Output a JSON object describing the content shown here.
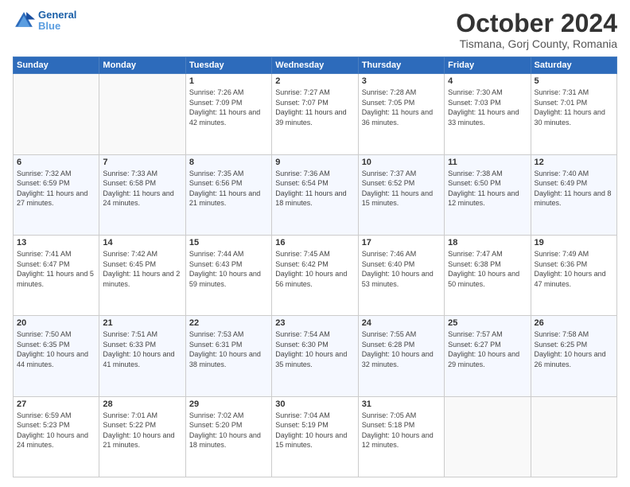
{
  "header": {
    "logo_line1": "General",
    "logo_line2": "Blue",
    "month": "October 2024",
    "location": "Tismana, Gorj County, Romania"
  },
  "weekdays": [
    "Sunday",
    "Monday",
    "Tuesday",
    "Wednesday",
    "Thursday",
    "Friday",
    "Saturday"
  ],
  "weeks": [
    [
      {
        "day": "",
        "sunrise": "",
        "sunset": "",
        "daylight": ""
      },
      {
        "day": "",
        "sunrise": "",
        "sunset": "",
        "daylight": ""
      },
      {
        "day": "1",
        "sunrise": "Sunrise: 7:26 AM",
        "sunset": "Sunset: 7:09 PM",
        "daylight": "Daylight: 11 hours and 42 minutes."
      },
      {
        "day": "2",
        "sunrise": "Sunrise: 7:27 AM",
        "sunset": "Sunset: 7:07 PM",
        "daylight": "Daylight: 11 hours and 39 minutes."
      },
      {
        "day": "3",
        "sunrise": "Sunrise: 7:28 AM",
        "sunset": "Sunset: 7:05 PM",
        "daylight": "Daylight: 11 hours and 36 minutes."
      },
      {
        "day": "4",
        "sunrise": "Sunrise: 7:30 AM",
        "sunset": "Sunset: 7:03 PM",
        "daylight": "Daylight: 11 hours and 33 minutes."
      },
      {
        "day": "5",
        "sunrise": "Sunrise: 7:31 AM",
        "sunset": "Sunset: 7:01 PM",
        "daylight": "Daylight: 11 hours and 30 minutes."
      }
    ],
    [
      {
        "day": "6",
        "sunrise": "Sunrise: 7:32 AM",
        "sunset": "Sunset: 6:59 PM",
        "daylight": "Daylight: 11 hours and 27 minutes."
      },
      {
        "day": "7",
        "sunrise": "Sunrise: 7:33 AM",
        "sunset": "Sunset: 6:58 PM",
        "daylight": "Daylight: 11 hours and 24 minutes."
      },
      {
        "day": "8",
        "sunrise": "Sunrise: 7:35 AM",
        "sunset": "Sunset: 6:56 PM",
        "daylight": "Daylight: 11 hours and 21 minutes."
      },
      {
        "day": "9",
        "sunrise": "Sunrise: 7:36 AM",
        "sunset": "Sunset: 6:54 PM",
        "daylight": "Daylight: 11 hours and 18 minutes."
      },
      {
        "day": "10",
        "sunrise": "Sunrise: 7:37 AM",
        "sunset": "Sunset: 6:52 PM",
        "daylight": "Daylight: 11 hours and 15 minutes."
      },
      {
        "day": "11",
        "sunrise": "Sunrise: 7:38 AM",
        "sunset": "Sunset: 6:50 PM",
        "daylight": "Daylight: 11 hours and 12 minutes."
      },
      {
        "day": "12",
        "sunrise": "Sunrise: 7:40 AM",
        "sunset": "Sunset: 6:49 PM",
        "daylight": "Daylight: 11 hours and 8 minutes."
      }
    ],
    [
      {
        "day": "13",
        "sunrise": "Sunrise: 7:41 AM",
        "sunset": "Sunset: 6:47 PM",
        "daylight": "Daylight: 11 hours and 5 minutes."
      },
      {
        "day": "14",
        "sunrise": "Sunrise: 7:42 AM",
        "sunset": "Sunset: 6:45 PM",
        "daylight": "Daylight: 11 hours and 2 minutes."
      },
      {
        "day": "15",
        "sunrise": "Sunrise: 7:44 AM",
        "sunset": "Sunset: 6:43 PM",
        "daylight": "Daylight: 10 hours and 59 minutes."
      },
      {
        "day": "16",
        "sunrise": "Sunrise: 7:45 AM",
        "sunset": "Sunset: 6:42 PM",
        "daylight": "Daylight: 10 hours and 56 minutes."
      },
      {
        "day": "17",
        "sunrise": "Sunrise: 7:46 AM",
        "sunset": "Sunset: 6:40 PM",
        "daylight": "Daylight: 10 hours and 53 minutes."
      },
      {
        "day": "18",
        "sunrise": "Sunrise: 7:47 AM",
        "sunset": "Sunset: 6:38 PM",
        "daylight": "Daylight: 10 hours and 50 minutes."
      },
      {
        "day": "19",
        "sunrise": "Sunrise: 7:49 AM",
        "sunset": "Sunset: 6:36 PM",
        "daylight": "Daylight: 10 hours and 47 minutes."
      }
    ],
    [
      {
        "day": "20",
        "sunrise": "Sunrise: 7:50 AM",
        "sunset": "Sunset: 6:35 PM",
        "daylight": "Daylight: 10 hours and 44 minutes."
      },
      {
        "day": "21",
        "sunrise": "Sunrise: 7:51 AM",
        "sunset": "Sunset: 6:33 PM",
        "daylight": "Daylight: 10 hours and 41 minutes."
      },
      {
        "day": "22",
        "sunrise": "Sunrise: 7:53 AM",
        "sunset": "Sunset: 6:31 PM",
        "daylight": "Daylight: 10 hours and 38 minutes."
      },
      {
        "day": "23",
        "sunrise": "Sunrise: 7:54 AM",
        "sunset": "Sunset: 6:30 PM",
        "daylight": "Daylight: 10 hours and 35 minutes."
      },
      {
        "day": "24",
        "sunrise": "Sunrise: 7:55 AM",
        "sunset": "Sunset: 6:28 PM",
        "daylight": "Daylight: 10 hours and 32 minutes."
      },
      {
        "day": "25",
        "sunrise": "Sunrise: 7:57 AM",
        "sunset": "Sunset: 6:27 PM",
        "daylight": "Daylight: 10 hours and 29 minutes."
      },
      {
        "day": "26",
        "sunrise": "Sunrise: 7:58 AM",
        "sunset": "Sunset: 6:25 PM",
        "daylight": "Daylight: 10 hours and 26 minutes."
      }
    ],
    [
      {
        "day": "27",
        "sunrise": "Sunrise: 6:59 AM",
        "sunset": "Sunset: 5:23 PM",
        "daylight": "Daylight: 10 hours and 24 minutes."
      },
      {
        "day": "28",
        "sunrise": "Sunrise: 7:01 AM",
        "sunset": "Sunset: 5:22 PM",
        "daylight": "Daylight: 10 hours and 21 minutes."
      },
      {
        "day": "29",
        "sunrise": "Sunrise: 7:02 AM",
        "sunset": "Sunset: 5:20 PM",
        "daylight": "Daylight: 10 hours and 18 minutes."
      },
      {
        "day": "30",
        "sunrise": "Sunrise: 7:04 AM",
        "sunset": "Sunset: 5:19 PM",
        "daylight": "Daylight: 10 hours and 15 minutes."
      },
      {
        "day": "31",
        "sunrise": "Sunrise: 7:05 AM",
        "sunset": "Sunset: 5:18 PM",
        "daylight": "Daylight: 10 hours and 12 minutes."
      },
      {
        "day": "",
        "sunrise": "",
        "sunset": "",
        "daylight": ""
      },
      {
        "day": "",
        "sunrise": "",
        "sunset": "",
        "daylight": ""
      }
    ]
  ]
}
